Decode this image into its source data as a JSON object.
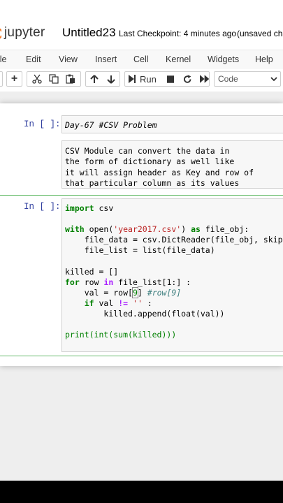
{
  "header": {
    "app_name": "jupyter",
    "notebook_name": "Untitled23",
    "checkpoint": "Last Checkpoint: 4 minutes ago",
    "status": "(unsaved cha"
  },
  "menu": [
    "ile",
    "Edit",
    "View",
    "Insert",
    "Cell",
    "Kernel",
    "Widgets",
    "Help"
  ],
  "toolbar": {
    "run_label": "Run",
    "cell_type": "Code"
  },
  "cells": [
    {
      "prompt": "In [ ]:",
      "source": "Day-67 #CSV Problem"
    },
    {
      "lines": [
        "CSV Module can convert the data in",
        "the form of dictionary as well like",
        "it will assign header as Key and row of",
        "that particular column as its values"
      ]
    },
    {
      "prompt": "In [ ]:"
    }
  ],
  "code": {
    "import_kw": "import",
    "import_mod": "csv",
    "with_kw": "with",
    "open_fn": "open(",
    "filename": "'year2017.csv'",
    "as_kw": "as",
    "file_obj": "file_obj:",
    "dictreader_line": "file_data = csv.DictReader(file_obj, skipi",
    "list_line": "file_list = list(file_data)",
    "killed_init": "killed = []",
    "for_kw": "for",
    "row_var": "row",
    "in_kw": "in",
    "slice_expr": "file_list[1:] :",
    "val_assign": "val = row[",
    "index": "9",
    "close_bracket": "]",
    "comment": "#row[9]",
    "if_kw": "if",
    "cond_val": "val",
    "neq": "!=",
    "empty_str": "''",
    "colon": ":",
    "append_line": "killed.append(float(val))",
    "print_line": "print(int(sum(killed)))"
  }
}
